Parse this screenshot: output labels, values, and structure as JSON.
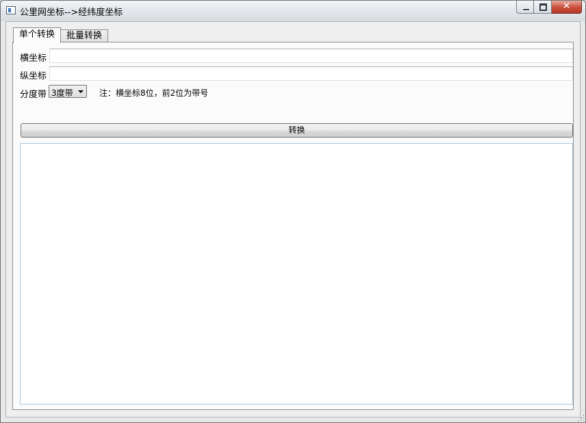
{
  "window": {
    "title": "公里网坐标-->经纬度坐标",
    "close_symbol": "✕"
  },
  "tabs": [
    {
      "label": "单个转换",
      "active": true
    },
    {
      "label": "批量转换",
      "active": false
    }
  ],
  "form": {
    "x_label": "横坐标",
    "x_value": "",
    "y_label": "纵坐标",
    "y_value": "",
    "zone_label": "分度带",
    "zone_selected": "3度带",
    "note": "注：横坐标8位，前2位为带号",
    "convert_label": "转换",
    "output_value": ""
  },
  "colors": {
    "panel_border": "#898c95",
    "output_border": "#a8c8dc",
    "close_button": "#c94e3a"
  }
}
